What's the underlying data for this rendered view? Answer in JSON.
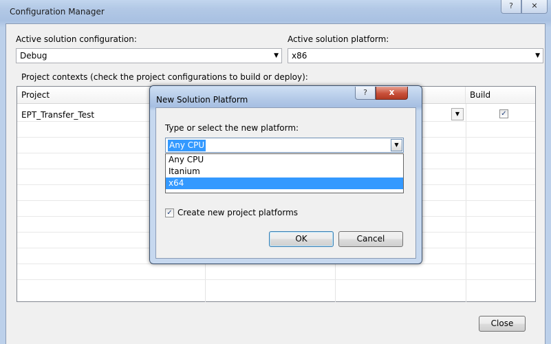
{
  "window": {
    "title": "Configuration Manager",
    "help_glyph": "?",
    "close_glyph": "✕"
  },
  "active_config": {
    "label": "Active solution configuration:",
    "value": "Debug"
  },
  "active_platform": {
    "label": "Active solution platform:",
    "value": "x86"
  },
  "contexts_label": "Project contexts (check the project configurations to build or deploy):",
  "grid": {
    "columns": [
      "Project",
      "",
      "",
      "Build"
    ],
    "rows": [
      {
        "project": "EPT_Transfer_Test",
        "build_checked": true
      }
    ]
  },
  "close_button": "Close",
  "dialog": {
    "title": "New Solution Platform",
    "help_glyph": "?",
    "close_glyph": "x",
    "prompt": "Type or select the new platform:",
    "value": "Any CPU",
    "options": [
      "Any CPU",
      "Itanium",
      "x64"
    ],
    "highlighted_option": "x64",
    "checkbox_label": "Create new project platforms",
    "checkbox_checked": true,
    "ok": "OK",
    "cancel": "Cancel"
  },
  "glyphs": {
    "dropdown": "▼",
    "check": "✓"
  },
  "colors": {
    "selection": "#3399ff",
    "titlebar": "#b3c9e6",
    "close_red": "#c8503a"
  }
}
